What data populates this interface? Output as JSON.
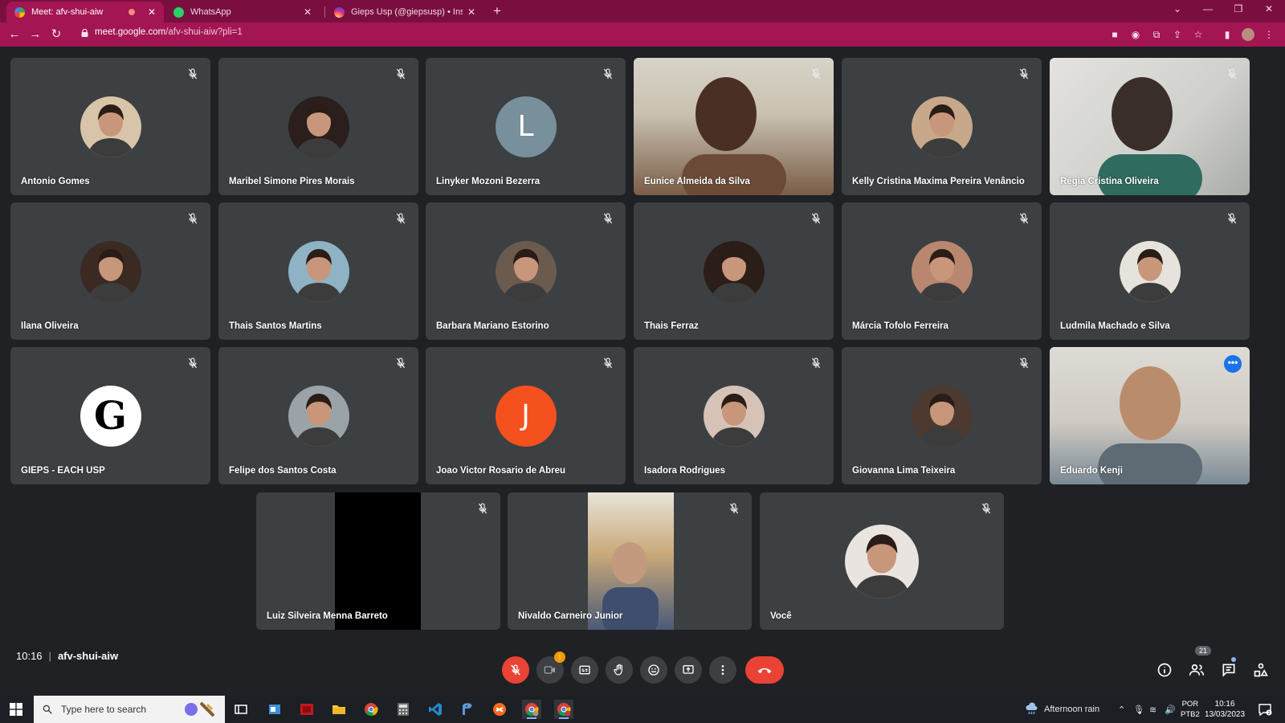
{
  "browser": {
    "tabs": [
      {
        "title": "Meet: afv-shui-aiw",
        "active": true
      },
      {
        "title": "WhatsApp",
        "active": false
      },
      {
        "title": "Gieps Usp (@giepsusp) • Instagra",
        "active": false
      }
    ],
    "url_host": "meet.google.com",
    "url_path": "/afv-shui-aiw?pli=1"
  },
  "participants": [
    {
      "name": "Antonio Gomes",
      "type": "photo",
      "tone": "#d8c4a8"
    },
    {
      "name": "Maribel Simone Pires Morais",
      "type": "photo",
      "tone": "#2a1f1c"
    },
    {
      "name": "Linyker Mozoni Bezerra",
      "type": "initial",
      "initial": "L",
      "color": "#78909c"
    },
    {
      "name": "Eunice Almeida da Silva",
      "type": "video"
    },
    {
      "name": "Kelly Cristina Maxima Pereira Venâncio",
      "type": "photo",
      "tone": "#c8a88a"
    },
    {
      "name": "Régia Cristina Oliveira",
      "type": "video"
    },
    {
      "name": "Ilana Oliveira",
      "type": "photo",
      "tone": "#3a2a22"
    },
    {
      "name": "Thais Santos Martins",
      "type": "photo",
      "tone": "#8fb2c5"
    },
    {
      "name": "Barbara Mariano Estorino",
      "type": "photo",
      "tone": "#6b5a4e"
    },
    {
      "name": "Thais Ferraz",
      "type": "photo",
      "tone": "#2b1d18"
    },
    {
      "name": "Márcia Tofolo Ferreira",
      "type": "photo",
      "tone": "#b98670"
    },
    {
      "name": "Ludmila Machado e Silva",
      "type": "photo",
      "tone": "#e6e2dc"
    },
    {
      "name": "GIEPS - EACH USP",
      "type": "logo",
      "initial": "G"
    },
    {
      "name": "Felipe dos Santos Costa",
      "type": "photo",
      "tone": "#9aa3a8"
    },
    {
      "name": "Joao Victor Rosario de Abreu",
      "type": "initial",
      "initial": "J",
      "color": "#f4511e"
    },
    {
      "name": "Isadora Rodrigues",
      "type": "photo",
      "tone": "#d7c2b7"
    },
    {
      "name": "Giovanna Lima Teixeira",
      "type": "photo",
      "tone": "#4c3a30"
    },
    {
      "name": "Eduardo Kenji",
      "type": "video",
      "highlight": true
    },
    {
      "name": "Luiz Silveira Menna Barreto",
      "type": "video"
    },
    {
      "name": "Nivaldo Carneiro Junior",
      "type": "video"
    },
    {
      "name": "Você",
      "type": "photo",
      "tone": "#e9e4df"
    }
  ],
  "meeting": {
    "time": "10:16",
    "code": "afv-shui-aiw",
    "participant_count": "21",
    "camera_badge": "!"
  },
  "icons": {
    "mic": "mic-off-icon",
    "camera": "camera-icon",
    "captions": "captions-icon",
    "hand": "raise-hand-icon",
    "emoji": "emoji-icon",
    "present": "present-icon",
    "more": "more-options-icon",
    "end": "end-call-icon",
    "info": "info-icon",
    "people": "people-icon",
    "chat": "chat-icon",
    "activities": "activities-icon"
  },
  "taskbar": {
    "search_placeholder": "Type here to search",
    "weather": "Afternoon rain",
    "lang_top": "POR",
    "lang_bottom": "PTB2",
    "clock_time": "10:16",
    "clock_date": "13/03/2023"
  },
  "colors": {
    "tab_strip": "#7a0f3f",
    "toolbar": "#a31553",
    "meet_bg": "#202124",
    "tile_bg": "#3c4043",
    "end_call": "#ea4335",
    "accent": "#8ab4f8"
  }
}
